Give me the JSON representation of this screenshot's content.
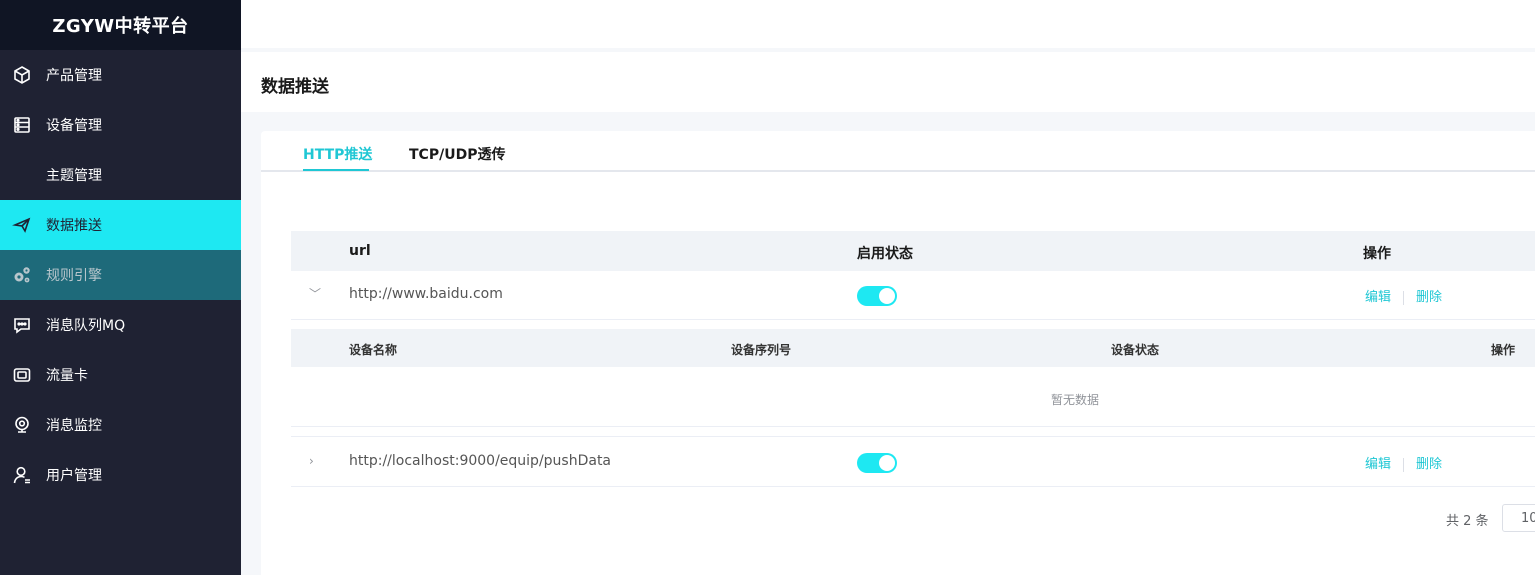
{
  "app": {
    "brand": "ZGYW中转平台"
  },
  "sidebar": {
    "items": [
      {
        "label": "产品管理",
        "icon": "cube-icon"
      },
      {
        "label": "设备管理",
        "icon": "server-icon"
      },
      {
        "label": "主题管理",
        "icon": ""
      },
      {
        "label": "数据推送",
        "icon": "send-icon",
        "state": "active"
      },
      {
        "label": "规则引擎",
        "icon": "gears-icon",
        "state": "hover"
      },
      {
        "label": "消息队列MQ",
        "icon": "message-icon"
      },
      {
        "label": "流量卡",
        "icon": "sim-card-icon"
      },
      {
        "label": "消息监控",
        "icon": "webcam-icon"
      },
      {
        "label": "用户管理",
        "icon": "user-icon"
      }
    ]
  },
  "page": {
    "title": "数据推送"
  },
  "tabs": [
    {
      "label": "HTTP推送",
      "active": true
    },
    {
      "label": "TCP/UDP透传",
      "active": false
    }
  ],
  "table": {
    "columns": {
      "url": "url",
      "status": "启用状态",
      "ops": "操作"
    },
    "rows": [
      {
        "url": "http://www.baidu.com",
        "enabled": true,
        "edit": "编辑",
        "delete": "删除",
        "expanded": true,
        "expander": "﹀"
      },
      {
        "url": "http://localhost:9000/equip/pushData",
        "enabled": true,
        "edit": "编辑",
        "delete": "删除",
        "expanded": false,
        "expander": "›"
      }
    ]
  },
  "subtable": {
    "columns": {
      "name": "设备名称",
      "serial": "设备序列号",
      "status": "设备状态",
      "ops": "操作"
    },
    "empty_text": "暂无数据"
  },
  "pagination": {
    "total_text": "共 2 条",
    "page_size": "10"
  },
  "colors": {
    "accent": "#1ee8f2",
    "link": "#1fc7d4",
    "sidebar_bg": "#1f2233",
    "brand_bg": "#101524"
  }
}
